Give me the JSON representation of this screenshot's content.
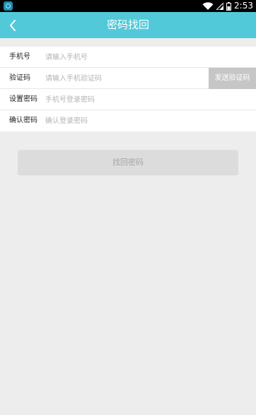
{
  "status_bar": {
    "time": "2:53",
    "icons": [
      "app-notification-icon",
      "wifi-icon",
      "signal-icon",
      "battery-icon"
    ]
  },
  "header": {
    "back_icon": "back-chevron-icon",
    "title": "密码找回",
    "background_color": "#52c9d8"
  },
  "form": {
    "fields": [
      {
        "label": "手机号",
        "placeholder": "请输入手机号",
        "value": ""
      },
      {
        "label": "验证码",
        "placeholder": "请输入手机验证码",
        "value": ""
      },
      {
        "label": "设置密码",
        "placeholder": "手机号登录密码",
        "value": ""
      },
      {
        "label": "确认密码",
        "placeholder": "确认登录密码",
        "value": ""
      }
    ],
    "send_code_label": "发送验证码"
  },
  "submit": {
    "label": "找回密码"
  }
}
